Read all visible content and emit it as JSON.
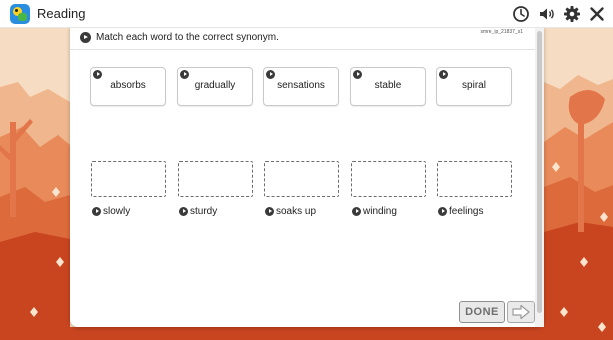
{
  "app": {
    "title": "Reading"
  },
  "toolbar": {
    "icons": [
      "clock-icon",
      "speaker-icon",
      "gear-icon",
      "close-icon"
    ]
  },
  "instruction": {
    "text": "Match each word to the correct synonym.",
    "skill_code": "smre_ip_21837_s1"
  },
  "words": [
    {
      "label": "absorbs"
    },
    {
      "label": "gradually"
    },
    {
      "label": "sensations"
    },
    {
      "label": "stable"
    },
    {
      "label": "spiral"
    }
  ],
  "synonyms": [
    {
      "label": "slowly"
    },
    {
      "label": "sturdy"
    },
    {
      "label": "soaks up"
    },
    {
      "label": "winding"
    },
    {
      "label": "feelings"
    }
  ],
  "buttons": {
    "done_label": "DONE"
  },
  "colors": {
    "accent": "#2a8ee0",
    "scene_dark": "#c94520",
    "scene_light": "#f7e0c8"
  }
}
